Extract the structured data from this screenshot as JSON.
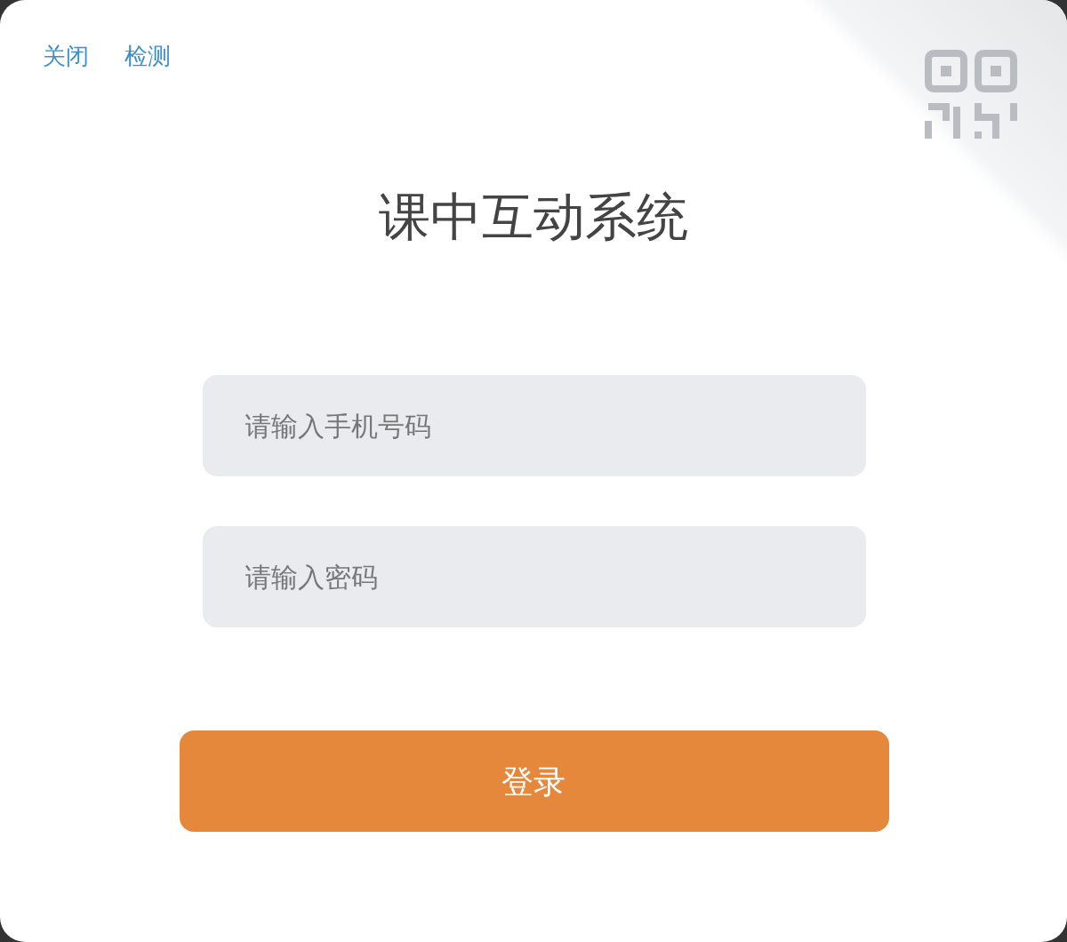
{
  "top_links": [
    "关闭",
    "检测"
  ],
  "title": "课中互动系统",
  "fields": [
    {
      "placeholder": "请输入手机号码"
    },
    {
      "placeholder": "请输入密码"
    }
  ],
  "login_button": "登录"
}
